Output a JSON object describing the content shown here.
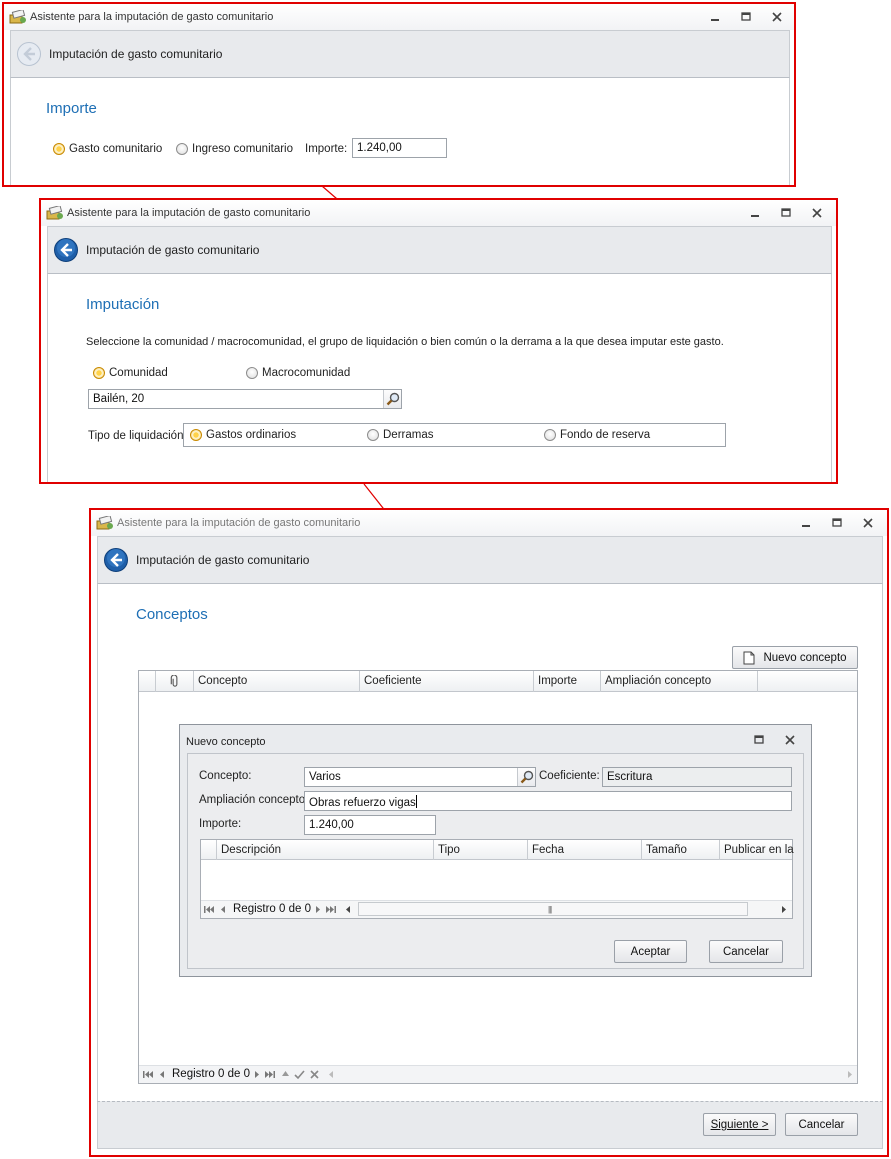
{
  "windows": {
    "window_title": "Asistente para la imputación de gasto comunitario",
    "header_title": "Imputación de gasto comunitario"
  },
  "step1": {
    "section_title": "Importe",
    "radio_gasto": "Gasto comunitario",
    "radio_ingreso": "Ingreso comunitario",
    "importe_label": "Importe:",
    "importe_value": "1.240,00"
  },
  "step2": {
    "section_title": "Imputación",
    "instruction": "Seleccione la comunidad / macrocomunidad, el grupo de liquidación o bien común o la derrama a la que desea imputar este gasto.",
    "radio_comunidad": "Comunidad",
    "radio_macro": "Macrocomunidad",
    "comunidad_value": "Bailén, 20",
    "tipo_label": "Tipo de liquidación:",
    "radio_ordinarios": "Gastos ordinarios",
    "radio_derramas": "Derramas",
    "radio_reserva": "Fondo de reserva"
  },
  "step3": {
    "section_title": "Conceptos",
    "nuevo_concepto_button": "Nuevo concepto",
    "columns": [
      "Concepto",
      "Coeficiente",
      "Importe",
      "Ampliación concepto"
    ],
    "nav_text": "Registro 0 de 0",
    "siguiente_button": "Siguiente >",
    "cancelar_button": "Cancelar"
  },
  "dialog": {
    "title": "Nuevo concepto",
    "concepto_label": "Concepto:",
    "concepto_value": "Varios",
    "coeficiente_label": "Coeficiente:",
    "coeficiente_value": "Escritura",
    "ampliacion_label": "Ampliación concepto:",
    "ampliacion_value": "Obras refuerzo vigas",
    "importe_label": "Importe:",
    "importe_value": "1.240,00",
    "columns": [
      "Descripción",
      "Tipo",
      "Fecha",
      "Tamaño",
      "Publicar en la w"
    ],
    "nav_text": "Registro 0 de 0",
    "aceptar_button": "Aceptar",
    "cancelar_button": "Cancelar"
  },
  "colors": {
    "highlight_border": "#e00000",
    "section_title": "#1e6fb5"
  }
}
